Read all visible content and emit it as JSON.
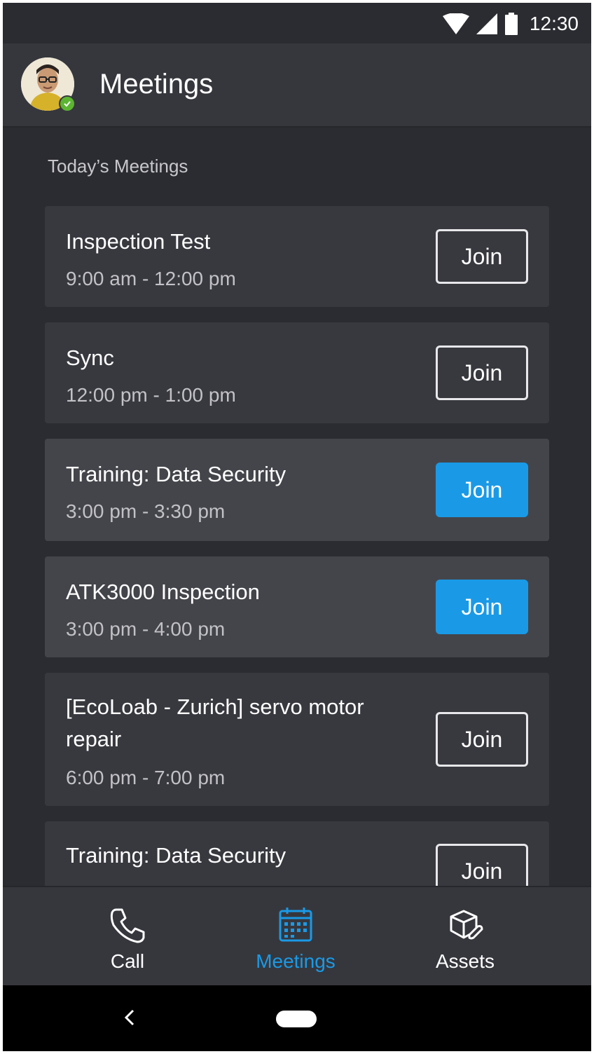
{
  "status_bar": {
    "time": "12:30",
    "icons": [
      "wifi-icon",
      "cellular-signal-icon",
      "battery-icon"
    ]
  },
  "header": {
    "title": "Meetings",
    "avatar": "user-avatar",
    "presence": "available"
  },
  "section": {
    "title": "Today’s Meetings"
  },
  "meetings": [
    {
      "title": "Inspection Test",
      "time": "9:00 am - 12:00 pm",
      "join_label": "Join",
      "style": "outline"
    },
    {
      "title": "Sync",
      "time": "12:00 pm - 1:00 pm",
      "join_label": "Join",
      "style": "outline"
    },
    {
      "title": "Training: Data Security",
      "time": "3:00 pm - 3:30 pm",
      "join_label": "Join",
      "style": "primary"
    },
    {
      "title": "ATK3000 Inspection",
      "time": "3:00 pm - 4:00 pm",
      "join_label": "Join",
      "style": "primary"
    },
    {
      "title": "[EcoLoab - Zurich] servo motor repair",
      "time": "6:00 pm - 7:00 pm",
      "join_label": "Join",
      "style": "outline"
    },
    {
      "title": "Training: Data Security",
      "time": "",
      "join_label": "Join",
      "style": "outline"
    }
  ],
  "bottom_nav": {
    "items": [
      {
        "label": "Call",
        "icon": "phone-icon",
        "selected": false
      },
      {
        "label": "Meetings",
        "icon": "calendar-icon",
        "selected": true
      },
      {
        "label": "Assets",
        "icon": "assets-icon",
        "selected": false
      }
    ]
  },
  "colors": {
    "background": "#2b2c31",
    "card": "#38393f",
    "accent": "#1a9ae6",
    "presence": "#5cb531"
  }
}
